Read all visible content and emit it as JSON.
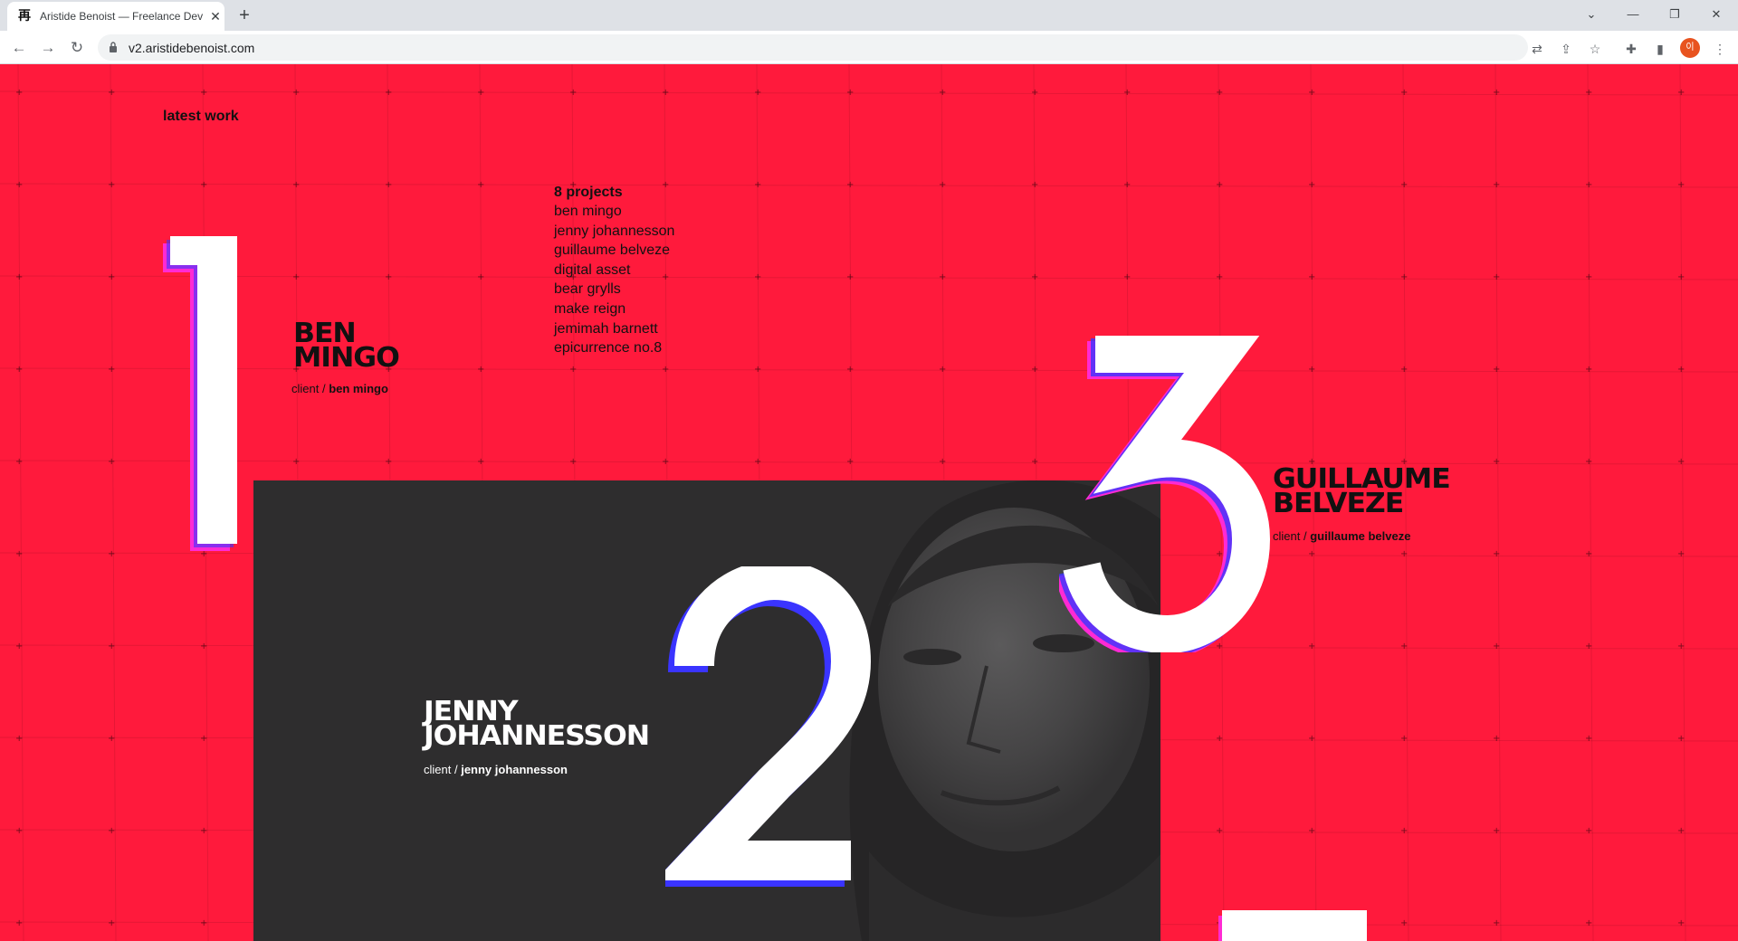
{
  "browser": {
    "tab_title": "Aristide Benoist — Freelance Developer",
    "favicon_glyph": "再",
    "close_glyph": "✕",
    "new_tab_glyph": "+",
    "url": "v2.aristidebenoist.com",
    "avatar_initial": "이"
  },
  "page": {
    "section_label": "latest work",
    "projects_count": "8 projects",
    "projects": [
      "ben mingo",
      "jenny johannesson",
      "guillaume belveze",
      "digital asset",
      "bear grylls",
      "make reign",
      "jemimah barnett",
      "epicurrence no.8"
    ],
    "work": [
      {
        "number": "1",
        "title_line1": "BEN",
        "title_line2": "MINGO",
        "client_prefix": "client /",
        "client_name": "ben mingo"
      },
      {
        "number": "2",
        "title_line1": "JENNY",
        "title_line2": "JOHANNESSON",
        "client_prefix": "client /",
        "client_name": "jenny johannesson"
      },
      {
        "number": "3",
        "title_line1": "GUILLAUME",
        "title_line2": "BELVEZE",
        "client_prefix": "client /",
        "client_name": "guillaume belveze"
      }
    ]
  },
  "colors": {
    "background": "#ff1a3c",
    "panel": "#2e2d2e",
    "numeral_fill": "#ffffff",
    "numeral_shadow_magenta": "#ff2ad4",
    "numeral_shadow_blue": "#3a34ff"
  }
}
